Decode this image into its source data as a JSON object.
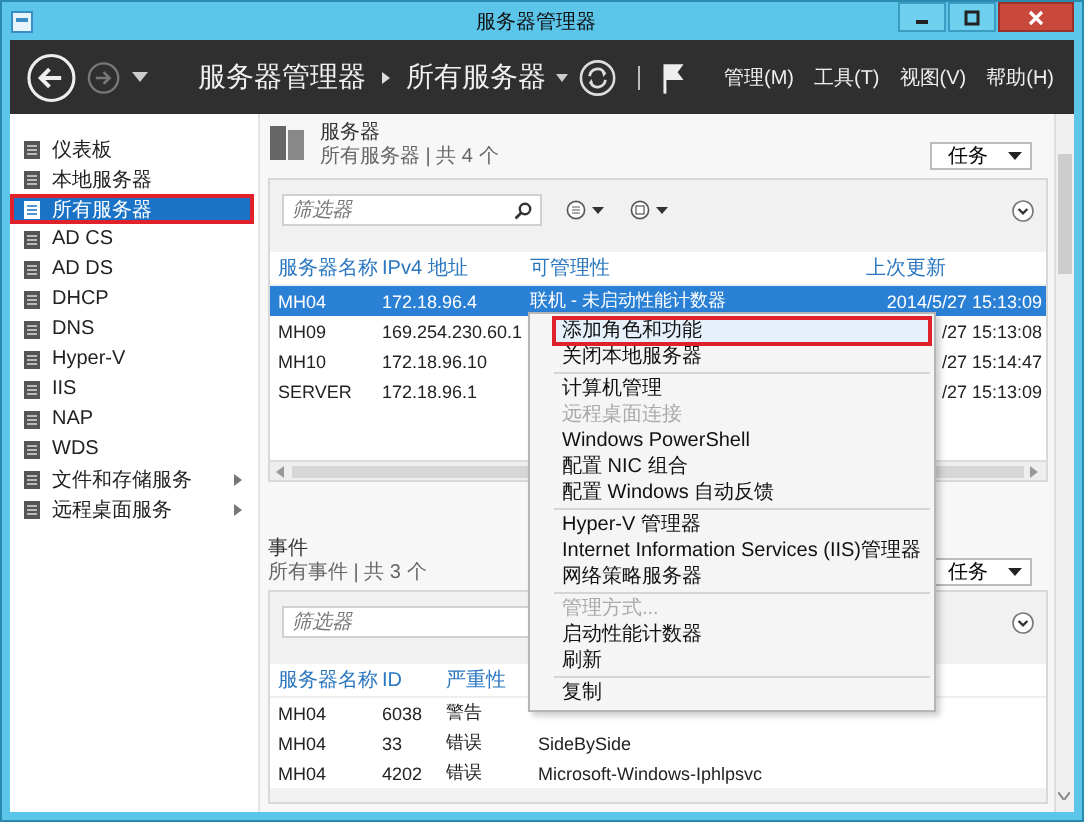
{
  "window": {
    "title": "服务器管理器"
  },
  "header": {
    "breadcrumb": [
      "服务器管理器",
      "所有服务器"
    ],
    "menus": [
      "管理(M)",
      "工具(T)",
      "视图(V)",
      "帮助(H)"
    ]
  },
  "sidebar": {
    "items": [
      {
        "label": "仪表板",
        "selected": false,
        "has_submenu": false,
        "highlight_box": false
      },
      {
        "label": "本地服务器",
        "selected": false,
        "has_submenu": false,
        "highlight_box": false
      },
      {
        "label": "所有服务器",
        "selected": true,
        "has_submenu": false,
        "highlight_box": true
      },
      {
        "label": "AD CS",
        "selected": false,
        "has_submenu": false,
        "highlight_box": false
      },
      {
        "label": "AD DS",
        "selected": false,
        "has_submenu": false,
        "highlight_box": false
      },
      {
        "label": "DHCP",
        "selected": false,
        "has_submenu": false,
        "highlight_box": false
      },
      {
        "label": "DNS",
        "selected": false,
        "has_submenu": false,
        "highlight_box": false
      },
      {
        "label": "Hyper-V",
        "selected": false,
        "has_submenu": false,
        "highlight_box": false
      },
      {
        "label": "IIS",
        "selected": false,
        "has_submenu": false,
        "highlight_box": false
      },
      {
        "label": "NAP",
        "selected": false,
        "has_submenu": false,
        "highlight_box": false
      },
      {
        "label": "WDS",
        "selected": false,
        "has_submenu": false,
        "highlight_box": false
      },
      {
        "label": "文件和存储服务",
        "selected": false,
        "has_submenu": true,
        "highlight_box": false
      },
      {
        "label": "远程桌面服务",
        "selected": false,
        "has_submenu": true,
        "highlight_box": false
      }
    ]
  },
  "servers": {
    "title": "服务器",
    "subtitle": "所有服务器 | 共 4 个",
    "tasks": "任务",
    "filter": {
      "placeholder": "筛选器"
    },
    "columns": {
      "name": "服务器名称",
      "ipv4": "IPv4 地址",
      "manageability": "可管理性",
      "last_update": "上次更新"
    },
    "rows": [
      {
        "name": "MH04",
        "ipv4": "172.18.96.4",
        "manageability": "联机 - 未启动性能计数器",
        "last_update": "2014/5/27 15:13:09",
        "selected": true
      },
      {
        "name": "MH09",
        "ipv4": "169.254.230.60.1",
        "last_update": "/27 15:13:08",
        "selected": false
      },
      {
        "name": "MH10",
        "ipv4": "172.18.96.10",
        "last_update": "/27 15:14:47",
        "selected": false
      },
      {
        "name": "SERVER",
        "ipv4": "172.18.96.1",
        "last_update": "/27 15:13:09",
        "selected": false
      }
    ]
  },
  "events": {
    "title": "事件",
    "subtitle": "所有事件 | 共 3 个",
    "tasks": "任务",
    "filter": {
      "placeholder": "筛选器"
    },
    "columns": {
      "server": "服务器名称",
      "id": "ID",
      "severity": "严重性"
    },
    "rows": [
      {
        "server": "MH04",
        "id": "6038",
        "severity": "警告"
      },
      {
        "server": "MH04",
        "id": "33",
        "severity": "错误",
        "source": "SideBySide"
      },
      {
        "server": "MH04",
        "id": "4202",
        "severity": "错误",
        "source": "Microsoft-Windows-Iphlpsvc"
      }
    ]
  },
  "context_menu": {
    "items": [
      {
        "kind": "item",
        "label": "添加角色和功能",
        "disabled": false,
        "hovered": true,
        "highlight_box": true
      },
      {
        "kind": "item",
        "label": "关闭本地服务器",
        "disabled": false,
        "hovered": false,
        "highlight_box": false
      },
      {
        "kind": "separator"
      },
      {
        "kind": "item",
        "label": "计算机管理",
        "disabled": false,
        "hovered": false,
        "highlight_box": false
      },
      {
        "kind": "item",
        "label": "远程桌面连接",
        "disabled": true,
        "hovered": false,
        "highlight_box": false
      },
      {
        "kind": "item",
        "label": "Windows PowerShell",
        "disabled": false,
        "hovered": false,
        "highlight_box": false
      },
      {
        "kind": "item",
        "label": "配置 NIC 组合",
        "disabled": false,
        "hovered": false,
        "highlight_box": false
      },
      {
        "kind": "item",
        "label": "配置 Windows 自动反馈",
        "disabled": false,
        "hovered": false,
        "highlight_box": false
      },
      {
        "kind": "separator"
      },
      {
        "kind": "item",
        "label": "Hyper-V 管理器",
        "disabled": false,
        "hovered": false,
        "highlight_box": false
      },
      {
        "kind": "item",
        "label": "Internet Information Services (IIS)管理器",
        "disabled": false,
        "hovered": false,
        "highlight_box": false
      },
      {
        "kind": "item",
        "label": "网络策略服务器",
        "disabled": false,
        "hovered": false,
        "highlight_box": false
      },
      {
        "kind": "separator"
      },
      {
        "kind": "item",
        "label": "管理方式...",
        "disabled": true,
        "hovered": false,
        "highlight_box": false
      },
      {
        "kind": "item",
        "label": "启动性能计数器",
        "disabled": false,
        "hovered": false,
        "highlight_box": false
      },
      {
        "kind": "item",
        "label": "刷新",
        "disabled": false,
        "hovered": false,
        "highlight_box": false
      },
      {
        "kind": "separator"
      },
      {
        "kind": "item",
        "label": "复制",
        "disabled": false,
        "hovered": false,
        "highlight_box": false
      }
    ]
  }
}
